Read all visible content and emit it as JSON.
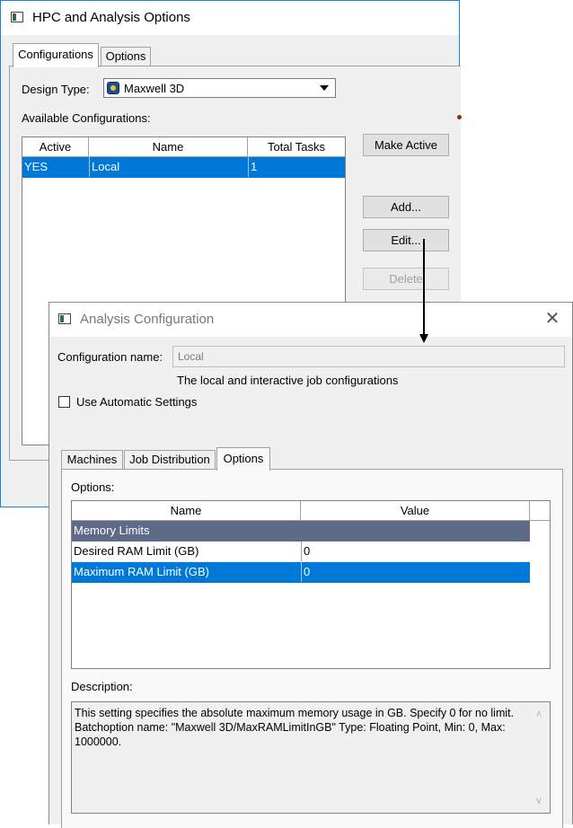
{
  "hpc_window": {
    "title": "HPC and Analysis Options",
    "tabs": [
      "Configurations",
      "Options"
    ],
    "design_type_label": "Design Type:",
    "design_type_value": "Maxwell 3D",
    "available_label": "Available Configurations:",
    "columns": [
      "Active",
      "Name",
      "Total Tasks"
    ],
    "rows": [
      {
        "active": "YES",
        "name": "Local",
        "tasks": "1"
      }
    ],
    "buttons": {
      "make_active": "Make Active",
      "add": "Add...",
      "edit": "Edit...",
      "delete": "Delete"
    }
  },
  "analysis_dialog": {
    "title": "Analysis Configuration",
    "config_name_label": "Configuration name:",
    "config_name_value": "Local",
    "config_description": "The local and interactive job configurations",
    "auto_settings_label": "Use Automatic Settings",
    "auto_settings_checked": false,
    "tabs": [
      "Machines",
      "Job Distribution",
      "Options"
    ],
    "active_tab": "Options",
    "options_label": "Options:",
    "columns": [
      "Name",
      "Value"
    ],
    "rows": [
      {
        "name": "Memory Limits",
        "value": ""
      },
      {
        "name": "Desired RAM Limit (GB)",
        "value": "0"
      },
      {
        "name": "Maximum RAM Limit (GB)",
        "value": "0"
      }
    ],
    "description_label": "Description:",
    "description_text": "This setting specifies the absolute maximum memory usage in GB. Specify 0 for no limit.\nBatchoption name: \"Maxwell 3D/MaxRAMLimitInGB\" Type: Floating Point, Min: 0, Max: 1000000."
  },
  "colors": {
    "accent": "#0078d7",
    "group_row": "#5f6b86",
    "window_border": "#1883d7"
  }
}
